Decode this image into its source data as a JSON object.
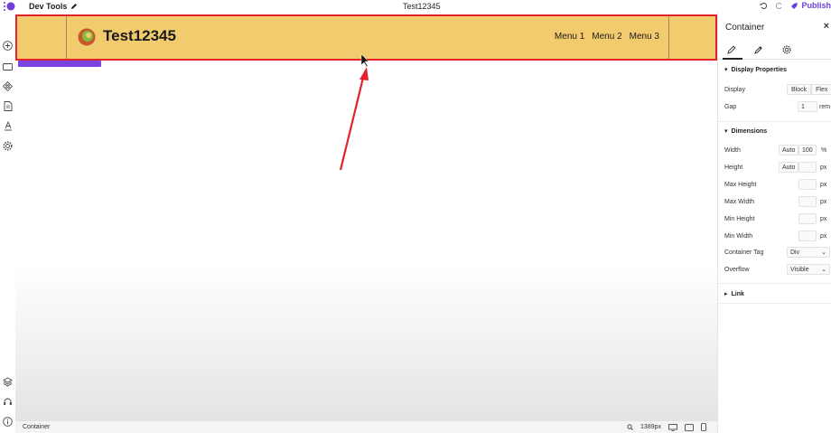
{
  "app": {
    "title": "Dev Tools",
    "page_title": "Test12345",
    "publish_label": "Publish"
  },
  "site": {
    "title": "Test12345",
    "menu": [
      "Menu 1",
      "Menu 2",
      "Menu 3"
    ]
  },
  "canvas": {
    "selected_tag": "Container"
  },
  "bottombar": {
    "breadcrumb": "Container",
    "width_readout": "1389px"
  },
  "panel": {
    "title": "Container",
    "display_section": "Display Properties",
    "display_label": "Display",
    "display_options": [
      "Block",
      "Flex"
    ],
    "gap_label": "Gap",
    "gap_value": "1",
    "gap_unit": "rem",
    "dimensions_section": "Dimensions",
    "width_label": "Width",
    "width_auto": "Auto",
    "width_value": "100",
    "width_unit": "%",
    "height_label": "Height",
    "height_auto": "Auto",
    "height_unit": "px",
    "max_height_label": "Max Height",
    "max_height_unit": "px",
    "max_width_label": "Max Width",
    "max_width_unit": "px",
    "min_height_label": "Min Height",
    "min_height_unit": "px",
    "min_width_label": "Min Width",
    "min_width_unit": "px",
    "tag_label": "Container Tag",
    "tag_value": "Div",
    "overflow_label": "Overflow",
    "overflow_value": "Visible",
    "link_section": "Link"
  },
  "colors": {
    "header_bg": "#f2cb6e",
    "selection": "#e3222b",
    "accent": "#7a44e0",
    "arrow": "#e3222b"
  }
}
